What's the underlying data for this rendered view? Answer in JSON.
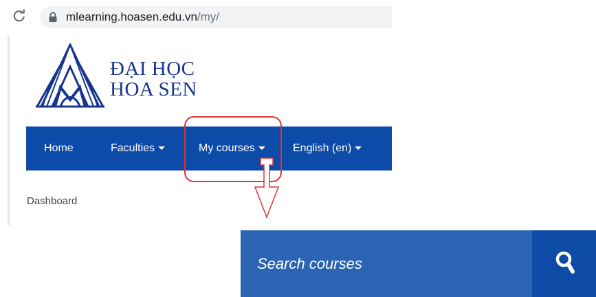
{
  "browser": {
    "url_host": "mlearning.hoasen.edu.vn",
    "url_path": "/my/",
    "icons": {
      "reload": "reload-icon",
      "lock": "lock-icon"
    }
  },
  "logo": {
    "line1": "ĐẠI HỌC",
    "line2": "HOA SEN",
    "brand_color": "#17358f"
  },
  "navbar": {
    "color": "#0d4ba8",
    "items": [
      {
        "label": "Home",
        "has_caret": false
      },
      {
        "label": "Faculties",
        "has_caret": true
      },
      {
        "label": "My courses",
        "has_caret": true,
        "highlighted": true
      },
      {
        "label": "English (en)",
        "has_caret": true
      }
    ]
  },
  "breadcrumb": {
    "label": "Dashboard"
  },
  "annotation": {
    "highlight_color": "#e0323a"
  },
  "search": {
    "placeholder": "Search courses",
    "bar_color": "#2b64b2",
    "button_color": "#0e4ba7",
    "button_icon": "search-icon"
  }
}
